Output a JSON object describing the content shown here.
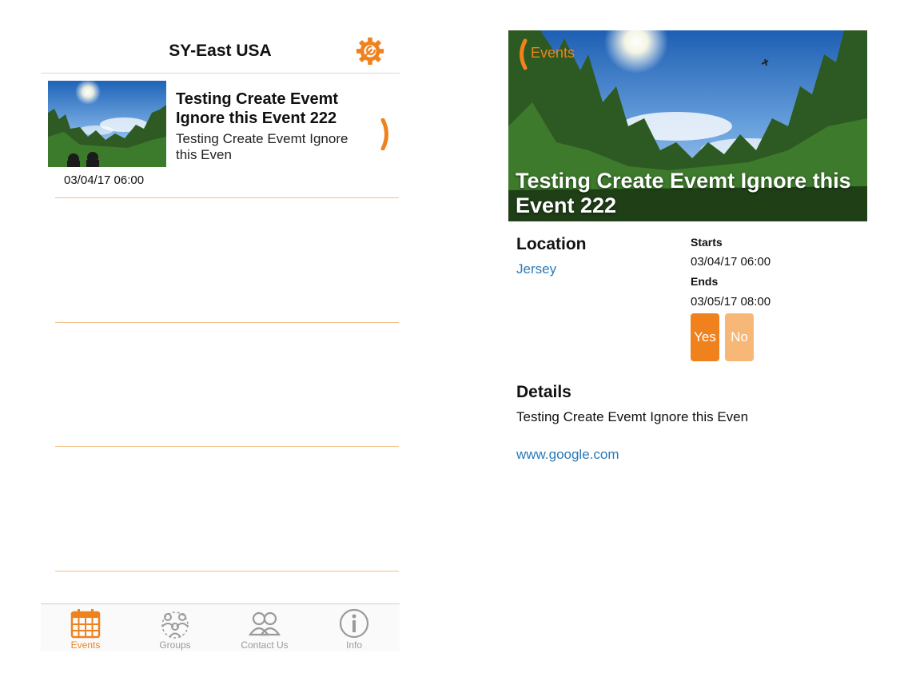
{
  "list_screen": {
    "title": "SY-East USA",
    "settings_icon": "gear-icon",
    "accent_color": "#f0821e",
    "events": [
      {
        "title": "Testing Create Evemt Ignore this Event 222",
        "subtitle": "Testing Create Evemt Ignore this Even",
        "date": "03/04/17 06:00"
      }
    ],
    "tabs": [
      {
        "label": "Events",
        "icon": "calendar-icon",
        "active": true
      },
      {
        "label": "Groups",
        "icon": "groups-icon",
        "active": false
      },
      {
        "label": "Contact Us",
        "icon": "contact-icon",
        "active": false
      },
      {
        "label": "Info",
        "icon": "info-icon",
        "active": false
      }
    ]
  },
  "detail_screen": {
    "back_label": "Events",
    "title": "Testing Create Evemt Ignore this Event 222",
    "location_heading": "Location",
    "location": "Jersey",
    "starts_label": "Starts",
    "starts": "03/04/17 06:00",
    "ends_label": "Ends",
    "ends": "03/05/17 08:00",
    "yes_label": "Yes",
    "no_label": "No",
    "details_heading": "Details",
    "details": "Testing Create Evemt Ignore this Even",
    "link": "www.google.com",
    "link_color": "#2a7ab8"
  }
}
